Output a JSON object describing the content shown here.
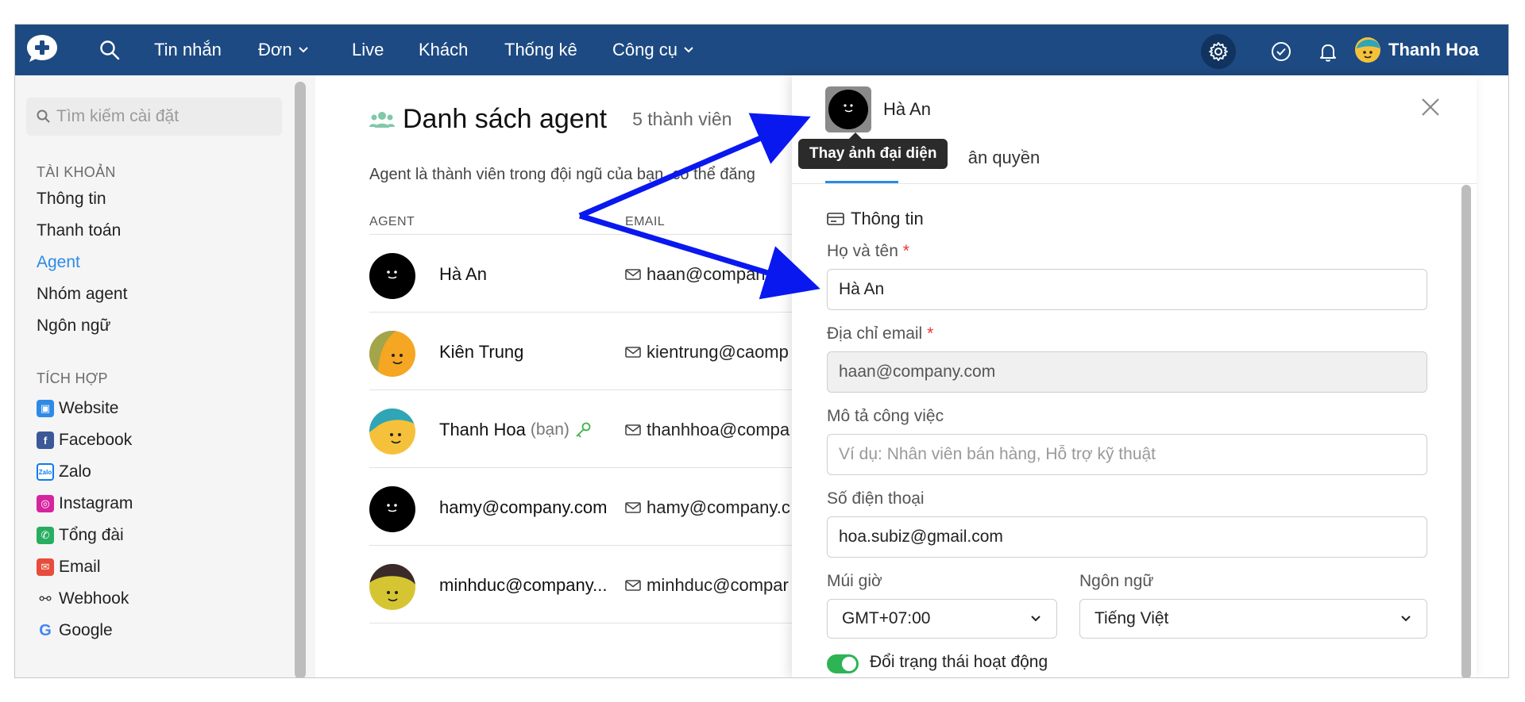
{
  "nav": {
    "items": [
      {
        "label": "Tin nhắn",
        "dropdown": false
      },
      {
        "label": "Đơn",
        "dropdown": true
      },
      {
        "label": "Live",
        "dropdown": false
      },
      {
        "label": "Khách",
        "dropdown": false
      },
      {
        "label": "Thống kê",
        "dropdown": false
      },
      {
        "label": "Công cụ",
        "dropdown": true
      }
    ],
    "user_name": "Thanh Hoa"
  },
  "sidebar": {
    "search_placeholder": "Tìm kiếm cài đặt",
    "account_heading": "TÀI KHOẢN",
    "account_items": [
      "Thông tin",
      "Thanh toán",
      "Agent",
      "Nhóm agent",
      "Ngôn ngữ"
    ],
    "active_item": "Agent",
    "integration_heading": "TÍCH HỢP",
    "integration_items": [
      "Website",
      "Facebook",
      "Zalo",
      "Instagram",
      "Tổng đài",
      "Email",
      "Webhook",
      "Google"
    ]
  },
  "main": {
    "title": "Danh sách agent",
    "member_count": "5 thành viên",
    "description": "Agent là thành viên trong đội ngũ của bạn, có thể đăng",
    "col_agent": "AGENT",
    "col_email": "EMAIL",
    "agents": [
      {
        "name": "Hà An",
        "you": "",
        "email": "haan@company.co"
      },
      {
        "name": "Kiên Trung",
        "you": "",
        "email": "kientrung@caomp"
      },
      {
        "name": "Thanh Hoa",
        "you": "(bạn)",
        "email": "thanhhoa@compa"
      },
      {
        "name": "hamy@company.com",
        "you": "",
        "email": "hamy@company.c"
      },
      {
        "name": "minhduc@company...",
        "you": "",
        "email": "minhduc@compar"
      }
    ]
  },
  "panel": {
    "name": "Hà An",
    "tooltip": "Thay ảnh đại diện",
    "tabs": [
      "Thông tin",
      "Phân quyền"
    ],
    "tab_visible_suffix": "ân quyền",
    "section_title": "Thông tin",
    "fields": {
      "fullname_label": "Họ và tên",
      "fullname_value": "Hà An",
      "email_label": "Địa chỉ email",
      "email_value": "haan@company.com",
      "job_label": "Mô tả công việc",
      "job_placeholder": "Ví dụ: Nhân viên bán hàng, Hỗ trợ kỹ thuật",
      "phone_label": "Số điện thoại",
      "phone_value": "hoa.subiz@gmail.com",
      "timezone_label": "Múi giờ",
      "timezone_value": "GMT+07:00",
      "language_label": "Ngôn ngữ",
      "language_value": "Tiếng Việt",
      "required_mark": "*"
    },
    "toggle_label": "Đổi trạng thái hoạt động",
    "toggle_on": true
  },
  "colors": {
    "nav_bg": "#1d4a82",
    "accent": "#2e8ae6",
    "arrow": "#0a18f0",
    "toggle_on": "#2fb455"
  }
}
